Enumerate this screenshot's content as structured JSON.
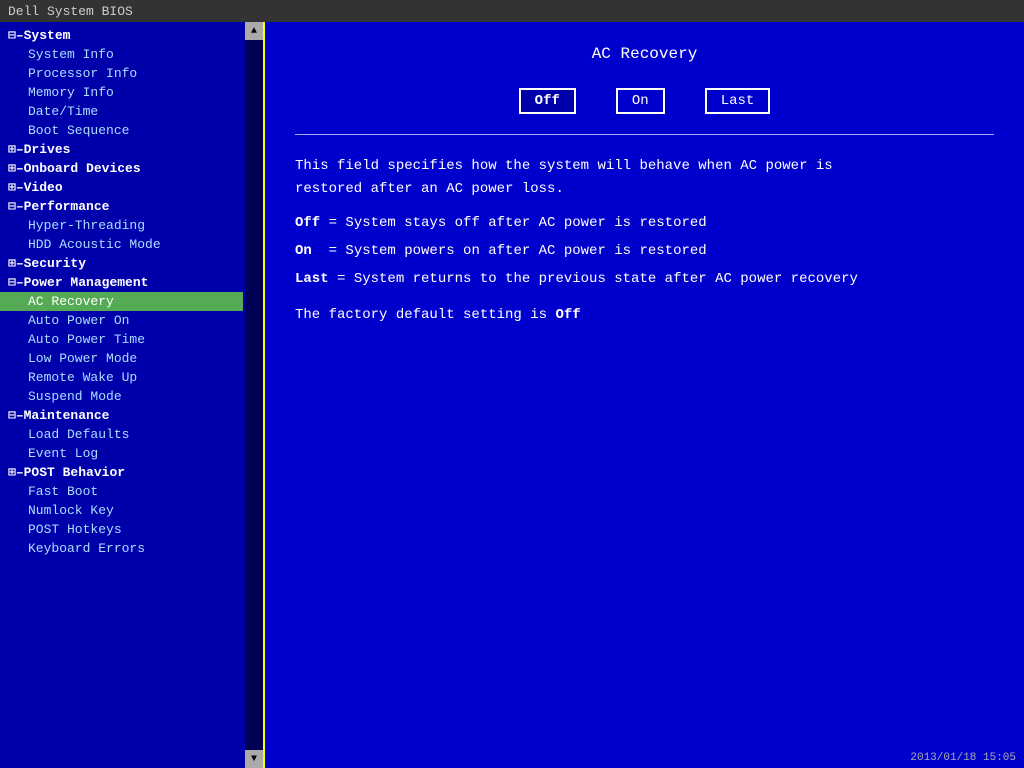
{
  "titlebar": {
    "text": "Dell System BIOS"
  },
  "sidebar": {
    "items": [
      {
        "id": "system",
        "label": "System",
        "type": "category-expand",
        "prefix": "⊟–"
      },
      {
        "id": "system-info",
        "label": "System Info",
        "type": "sub"
      },
      {
        "id": "processor-info",
        "label": "Processor Info",
        "type": "sub"
      },
      {
        "id": "memory-info",
        "label": "Memory Info",
        "type": "sub"
      },
      {
        "id": "date-time",
        "label": "Date/Time",
        "type": "sub"
      },
      {
        "id": "boot-sequence",
        "label": "Boot Sequence",
        "type": "sub"
      },
      {
        "id": "drives",
        "label": "Drives",
        "type": "category-expand",
        "prefix": "⊞–"
      },
      {
        "id": "onboard-devices",
        "label": "Onboard Devices",
        "type": "category-expand",
        "prefix": "⊞–"
      },
      {
        "id": "video",
        "label": "Video",
        "type": "category-expand",
        "prefix": "⊞–"
      },
      {
        "id": "performance",
        "label": "Performance",
        "type": "category-expand",
        "prefix": "⊟–"
      },
      {
        "id": "hyper-threading",
        "label": "Hyper-Threading",
        "type": "sub"
      },
      {
        "id": "hdd-acoustic",
        "label": "HDD Acoustic Mode",
        "type": "sub"
      },
      {
        "id": "security",
        "label": "Security",
        "type": "category-expand",
        "prefix": "⊞–"
      },
      {
        "id": "power-management",
        "label": "Power Management",
        "type": "category-expand",
        "prefix": "⊟–"
      },
      {
        "id": "ac-recovery",
        "label": "AC Recovery",
        "type": "sub",
        "active": true
      },
      {
        "id": "auto-power-on",
        "label": "Auto Power On",
        "type": "sub"
      },
      {
        "id": "auto-power-time",
        "label": "Auto Power Time",
        "type": "sub"
      },
      {
        "id": "low-power-mode",
        "label": "Low Power Mode",
        "type": "sub"
      },
      {
        "id": "remote-wake-up",
        "label": "Remote Wake Up",
        "type": "sub"
      },
      {
        "id": "suspend-mode",
        "label": "Suspend Mode",
        "type": "sub"
      },
      {
        "id": "maintenance",
        "label": "Maintenance",
        "type": "category-expand",
        "prefix": "⊟–"
      },
      {
        "id": "load-defaults",
        "label": "Load Defaults",
        "type": "sub"
      },
      {
        "id": "event-log",
        "label": "Event Log",
        "type": "sub"
      },
      {
        "id": "post-behavior",
        "label": "POST Behavior",
        "type": "category-expand",
        "prefix": "⊞–"
      },
      {
        "id": "fast-boot",
        "label": "Fast Boot",
        "type": "sub"
      },
      {
        "id": "numlock-key",
        "label": "Numlock Key",
        "type": "sub"
      },
      {
        "id": "post-hotkeys",
        "label": "POST Hotkeys",
        "type": "sub"
      },
      {
        "id": "keyboard-errors",
        "label": "Keyboard Errors",
        "type": "sub"
      }
    ],
    "scroll_up_icon": "▲",
    "scroll_down_icon": "▼"
  },
  "main": {
    "title": "AC Recovery",
    "options": [
      {
        "id": "off",
        "label": "Off",
        "selected": true
      },
      {
        "id": "on",
        "label": "On",
        "selected": false
      },
      {
        "id": "last",
        "label": "Last",
        "selected": false
      }
    ],
    "description_line1": "This field specifies how the system will behave when AC power is",
    "description_line2": "restored after an AC power loss.",
    "definitions": [
      {
        "term": "Off",
        "sep": " = ",
        "desc": "System stays off after AC power is restored"
      },
      {
        "term": "On",
        "sep": "  = ",
        "desc": "System powers on after AC power is restored"
      },
      {
        "term": "Last",
        "sep": " = ",
        "desc": "System returns to the previous state after AC power recovery"
      }
    ],
    "factory_default_prefix": "The factory default setting is ",
    "factory_default_value": "Off"
  },
  "timestamp": "2013/01/18 15:05"
}
